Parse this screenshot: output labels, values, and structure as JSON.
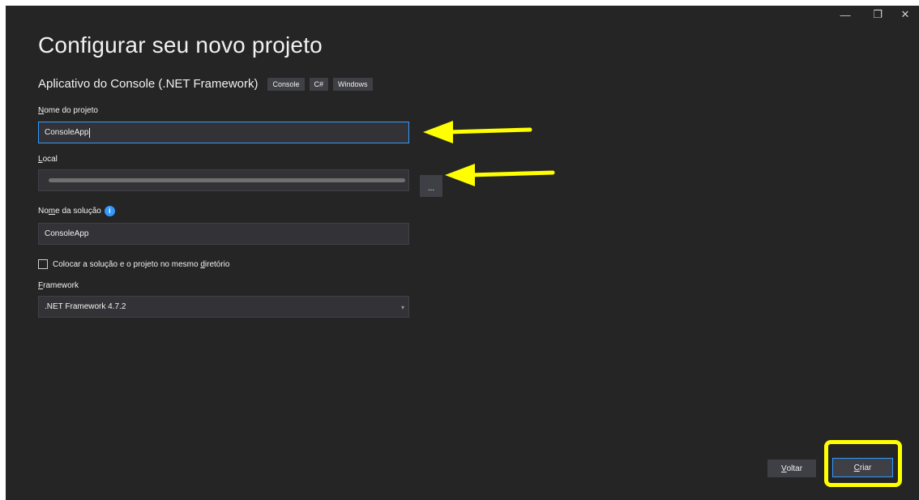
{
  "window": {
    "controls": {
      "minimize": "—",
      "restore": "❐",
      "close": "✕"
    }
  },
  "header": {
    "title": "Configurar seu novo projeto",
    "template_name": "Aplicativo do Console (.NET Framework)",
    "tags": [
      "Console",
      "C#",
      "Windows"
    ]
  },
  "form": {
    "project_name": {
      "label_first": "N",
      "label_rest": "ome do projeto",
      "value": "ConsoleApp"
    },
    "location": {
      "label_first": "L",
      "label_rest": "ocal",
      "browse_label": "..."
    },
    "solution_name": {
      "label_pre": "No",
      "label_key": "m",
      "label_rest": "e da solução",
      "value": "ConsoleApp"
    },
    "same_dir": {
      "label_pre": "Colocar a solução e o projeto no mesmo ",
      "label_key": "d",
      "label_rest": "iretório",
      "checked": false
    },
    "framework": {
      "label_first": "F",
      "label_rest": "ramework",
      "value": ".NET Framework 4.7.2"
    }
  },
  "footer": {
    "back_first": "V",
    "back_rest": "oltar",
    "create_first": "C",
    "create_rest": "riar"
  },
  "annotations": {
    "highlight_color": "#ffff00"
  }
}
